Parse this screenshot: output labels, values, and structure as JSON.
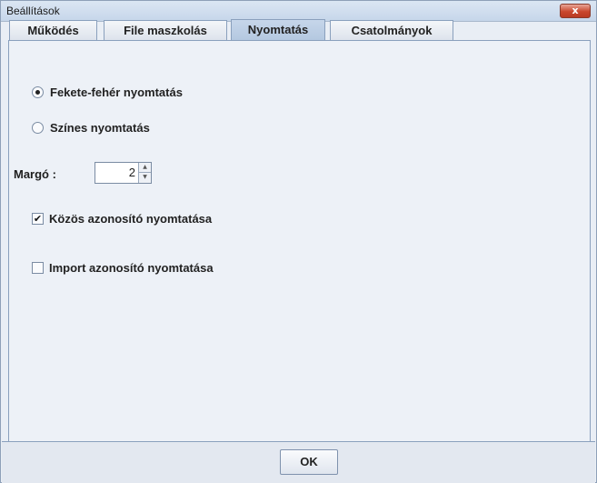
{
  "window": {
    "title": "Beállítások",
    "close_glyph": "x"
  },
  "tabs": [
    {
      "label": "Működés"
    },
    {
      "label": "File maszkolás"
    },
    {
      "label": "Nyomtatás"
    },
    {
      "label": "Csatolmányok"
    }
  ],
  "active_tab": "Nyomtatás",
  "print": {
    "bw_label": "Fekete-fehér nyomtatás",
    "bw_selected": true,
    "color_label": "Színes nyomtatás",
    "color_selected": false,
    "margin_label": "Margó :",
    "margin_value": "2",
    "common_id_label": "Közös azonosító nyomtatása",
    "common_id_checked": true,
    "import_id_label": "Import azonosító nyomtatása",
    "import_id_checked": false
  },
  "footer": {
    "ok_label": "OK"
  },
  "colors": {
    "active_tab": "#b4c8e0",
    "panel": "#edf1f7",
    "close_button": "#c9472d"
  }
}
